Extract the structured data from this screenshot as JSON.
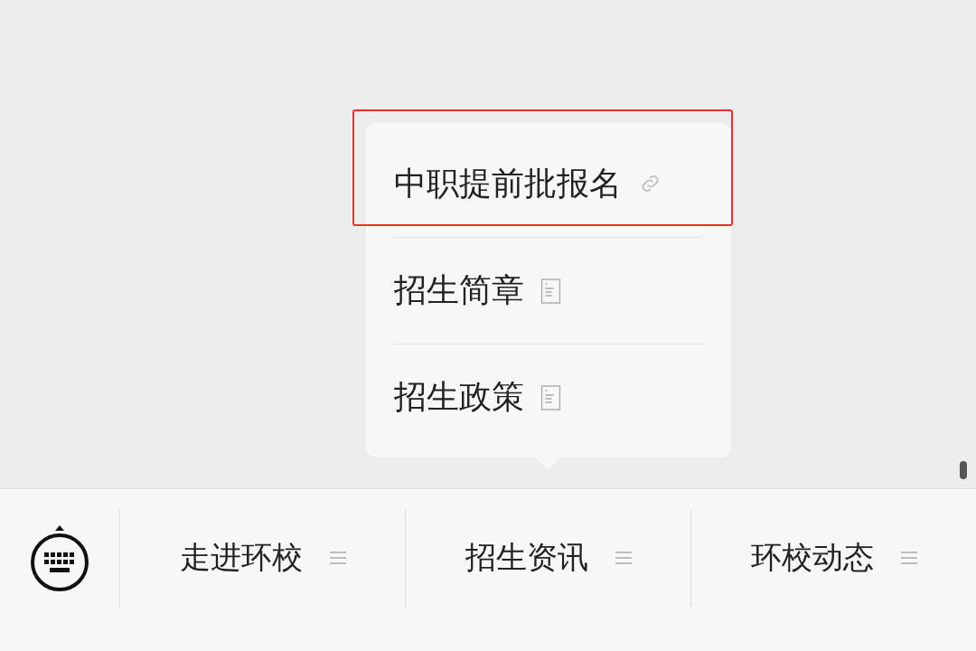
{
  "tabs": [
    {
      "label": "走进环校"
    },
    {
      "label": "招生资讯",
      "submenu": {
        "items": [
          {
            "label": "中职提前批报名",
            "kind": "link",
            "highlighted": true
          },
          {
            "label": "招生简章",
            "kind": "article",
            "highlighted": false
          },
          {
            "label": "招生政策",
            "kind": "article",
            "highlighted": false
          }
        ]
      }
    },
    {
      "label": "环校动态"
    }
  ]
}
